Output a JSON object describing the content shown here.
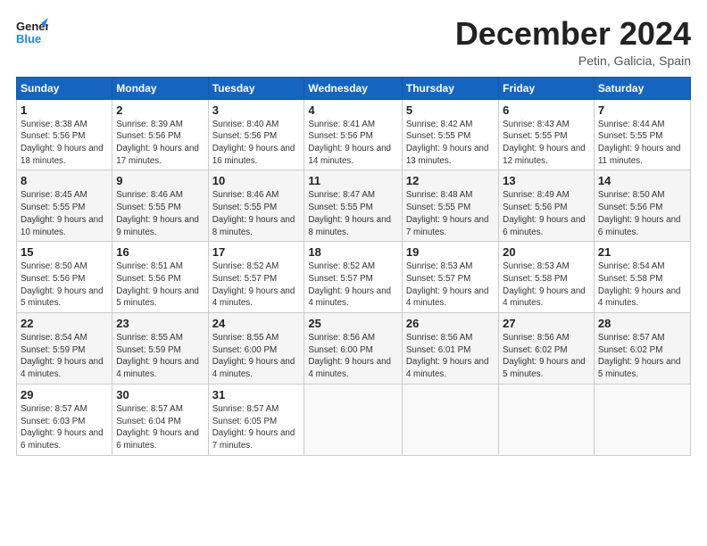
{
  "header": {
    "logo_general": "General",
    "logo_blue": "Blue",
    "month_title": "December 2024",
    "location": "Petin, Galicia, Spain"
  },
  "calendar": {
    "days_of_week": [
      "Sunday",
      "Monday",
      "Tuesday",
      "Wednesday",
      "Thursday",
      "Friday",
      "Saturday"
    ],
    "weeks": [
      [
        {
          "day": "1",
          "sunrise": "8:38 AM",
          "sunset": "5:56 PM",
          "daylight": "9 hours and 18 minutes."
        },
        {
          "day": "2",
          "sunrise": "8:39 AM",
          "sunset": "5:56 PM",
          "daylight": "9 hours and 17 minutes."
        },
        {
          "day": "3",
          "sunrise": "8:40 AM",
          "sunset": "5:56 PM",
          "daylight": "9 hours and 16 minutes."
        },
        {
          "day": "4",
          "sunrise": "8:41 AM",
          "sunset": "5:56 PM",
          "daylight": "9 hours and 14 minutes."
        },
        {
          "day": "5",
          "sunrise": "8:42 AM",
          "sunset": "5:55 PM",
          "daylight": "9 hours and 13 minutes."
        },
        {
          "day": "6",
          "sunrise": "8:43 AM",
          "sunset": "5:55 PM",
          "daylight": "9 hours and 12 minutes."
        },
        {
          "day": "7",
          "sunrise": "8:44 AM",
          "sunset": "5:55 PM",
          "daylight": "9 hours and 11 minutes."
        }
      ],
      [
        {
          "day": "8",
          "sunrise": "8:45 AM",
          "sunset": "5:55 PM",
          "daylight": "9 hours and 10 minutes."
        },
        {
          "day": "9",
          "sunrise": "8:46 AM",
          "sunset": "5:55 PM",
          "daylight": "9 hours and 9 minutes."
        },
        {
          "day": "10",
          "sunrise": "8:46 AM",
          "sunset": "5:55 PM",
          "daylight": "9 hours and 8 minutes."
        },
        {
          "day": "11",
          "sunrise": "8:47 AM",
          "sunset": "5:55 PM",
          "daylight": "9 hours and 8 minutes."
        },
        {
          "day": "12",
          "sunrise": "8:48 AM",
          "sunset": "5:55 PM",
          "daylight": "9 hours and 7 minutes."
        },
        {
          "day": "13",
          "sunrise": "8:49 AM",
          "sunset": "5:56 PM",
          "daylight": "9 hours and 6 minutes."
        },
        {
          "day": "14",
          "sunrise": "8:50 AM",
          "sunset": "5:56 PM",
          "daylight": "9 hours and 6 minutes."
        }
      ],
      [
        {
          "day": "15",
          "sunrise": "8:50 AM",
          "sunset": "5:56 PM",
          "daylight": "9 hours and 5 minutes."
        },
        {
          "day": "16",
          "sunrise": "8:51 AM",
          "sunset": "5:56 PM",
          "daylight": "9 hours and 5 minutes."
        },
        {
          "day": "17",
          "sunrise": "8:52 AM",
          "sunset": "5:57 PM",
          "daylight": "9 hours and 4 minutes."
        },
        {
          "day": "18",
          "sunrise": "8:52 AM",
          "sunset": "5:57 PM",
          "daylight": "9 hours and 4 minutes."
        },
        {
          "day": "19",
          "sunrise": "8:53 AM",
          "sunset": "5:57 PM",
          "daylight": "9 hours and 4 minutes."
        },
        {
          "day": "20",
          "sunrise": "8:53 AM",
          "sunset": "5:58 PM",
          "daylight": "9 hours and 4 minutes."
        },
        {
          "day": "21",
          "sunrise": "8:54 AM",
          "sunset": "5:58 PM",
          "daylight": "9 hours and 4 minutes."
        }
      ],
      [
        {
          "day": "22",
          "sunrise": "8:54 AM",
          "sunset": "5:59 PM",
          "daylight": "9 hours and 4 minutes."
        },
        {
          "day": "23",
          "sunrise": "8:55 AM",
          "sunset": "5:59 PM",
          "daylight": "9 hours and 4 minutes."
        },
        {
          "day": "24",
          "sunrise": "8:55 AM",
          "sunset": "6:00 PM",
          "daylight": "9 hours and 4 minutes."
        },
        {
          "day": "25",
          "sunrise": "8:56 AM",
          "sunset": "6:00 PM",
          "daylight": "9 hours and 4 minutes."
        },
        {
          "day": "26",
          "sunrise": "8:56 AM",
          "sunset": "6:01 PM",
          "daylight": "9 hours and 4 minutes."
        },
        {
          "day": "27",
          "sunrise": "8:56 AM",
          "sunset": "6:02 PM",
          "daylight": "9 hours and 5 minutes."
        },
        {
          "day": "28",
          "sunrise": "8:57 AM",
          "sunset": "6:02 PM",
          "daylight": "9 hours and 5 minutes."
        }
      ],
      [
        {
          "day": "29",
          "sunrise": "8:57 AM",
          "sunset": "6:03 PM",
          "daylight": "9 hours and 6 minutes."
        },
        {
          "day": "30",
          "sunrise": "8:57 AM",
          "sunset": "6:04 PM",
          "daylight": "9 hours and 6 minutes."
        },
        {
          "day": "31",
          "sunrise": "8:57 AM",
          "sunset": "6:05 PM",
          "daylight": "9 hours and 7 minutes."
        },
        null,
        null,
        null,
        null
      ]
    ]
  }
}
